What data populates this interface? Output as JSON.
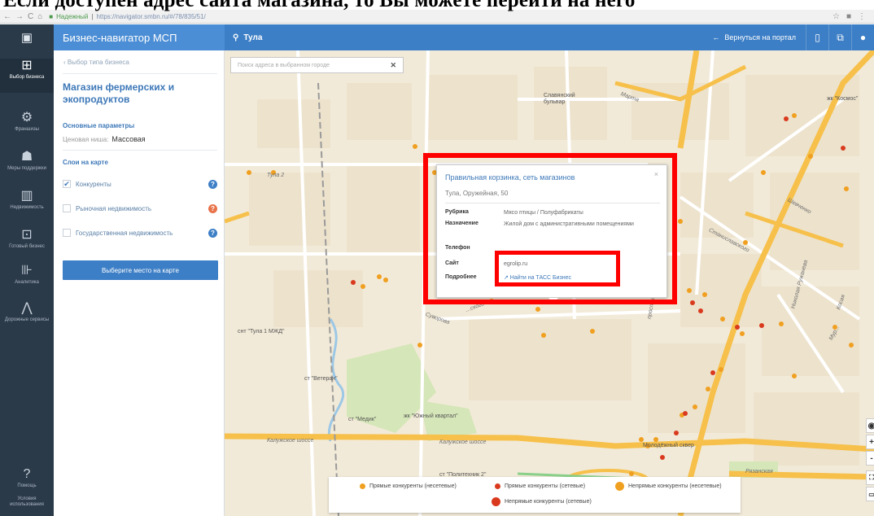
{
  "slide": {
    "heading": "Если доступен адрес сайта магазина, то Вы можете перейти на него"
  },
  "browser": {
    "secure_label": "Надежный",
    "url": "https://navigator.smbn.ru/#/78/835/51/",
    "nav_icons": [
      "back-icon",
      "forward-icon",
      "reload-icon",
      "home-icon"
    ]
  },
  "header": {
    "app_title": "Бизнес-навигатор МСП",
    "city": "Тула",
    "back_to_portal": "Вернуться на портал"
  },
  "rail": {
    "items": [
      {
        "label": "Выбор бизнеса",
        "icon": "briefcase-icon",
        "active": true
      },
      {
        "label": "Франшизы",
        "icon": "gear-icon",
        "active": false
      },
      {
        "label": "Меры поддержки",
        "icon": "people-icon",
        "active": false
      },
      {
        "label": "Недвижимость",
        "icon": "building-icon",
        "active": false
      },
      {
        "label": "Готовый бизнес",
        "icon": "store-icon",
        "active": false
      },
      {
        "label": "Аналитика",
        "icon": "chart-icon",
        "active": false
      },
      {
        "label": "Дорожные сервисы",
        "icon": "road-icon",
        "active": false
      },
      {
        "label": "Помощь",
        "icon": "help-icon",
        "active": false
      },
      {
        "label": "Условия использования",
        "icon": "",
        "active": false
      }
    ]
  },
  "panel": {
    "back_link": "‹ Выбор типа бизнеса",
    "title": "Магазин фермерских и экопродуктов",
    "params_heading": "Основные параметры",
    "param_label": "Ценовая ниша:",
    "param_value": "Массовая",
    "layers_heading": "Слои на карте",
    "layers": [
      {
        "label": "Конкуренты",
        "checked": true,
        "help_color": "#3d7fc6"
      },
      {
        "label": "Рыночная недвижимость",
        "checked": false,
        "help_color": "#e8734a"
      },
      {
        "label": "Государственная недвижимость",
        "checked": false,
        "help_color": "#3d7fc6"
      }
    ],
    "select_button": "Выберите место на карте"
  },
  "map": {
    "search_placeholder": "Поиск адреса в выбранном городе",
    "labels": {
      "slavyansky": "Славянский бульвар",
      "marta": "Марта",
      "kosmos": "жк \"Космос\"",
      "tula2": "Тула 2",
      "shevchenko": "Шевченко",
      "stanislavskogo": "Станиславского",
      "nikolaya_ruzhaneva": "Николая Ружанева",
      "kosaya": "Косая",
      "suvorova": "Суворова",
      "oskogo": "...ского",
      "prospekt_lenina": "проспект Ленина",
      "gnt_tula1": "снт \"Тула 1 МЖД\"",
      "veteran": "ст \"Ветеран\"",
      "medik": "ст \"Медик\"",
      "yuzhny": "жк \"Южный квартал\"",
      "kaluzhskoe1": "Калужское шоссе",
      "kaluzhskoe2": "Калужское шоссе",
      "molodezhny": "Молодёжный сквер",
      "ryazanskaya": "Рязанская",
      "politehnik": "ст \"Политехник 2\"",
      "mur": "Мур..."
    }
  },
  "popup": {
    "title": "Правильная корзинка, сеть магазинов",
    "address": "Тула, Оружейная, 50",
    "rows": [
      {
        "key": "Рубрика",
        "value": "Мясо птицы / Полуфабрикаты"
      },
      {
        "key": "Назначение",
        "value": "Жилой дом с административными помещениями"
      },
      {
        "key": "Телефон",
        "value": ""
      },
      {
        "key": "Сайт",
        "value": "egrolip.ru"
      },
      {
        "key": "Подробнее",
        "value": "↗ Найти на ТАСС Бизнес"
      }
    ]
  },
  "legend": {
    "items": [
      {
        "label": "Прямые конкуренты (несетевые)",
        "color": "#f0a020"
      },
      {
        "label": "Прямые конкуренты (сетевые)",
        "color": "#d93a1e"
      },
      {
        "label": "Непрямые конкуренты (несетевые)",
        "color": "#f0a020"
      },
      {
        "label": "Непрямые конкуренты (сетевые)",
        "color": "#d93a1e"
      }
    ]
  },
  "colors": {
    "primary": "#3d7fc6",
    "rail": "#2b3a49",
    "highlight": "#ff0000",
    "road": "#f6c04a"
  }
}
